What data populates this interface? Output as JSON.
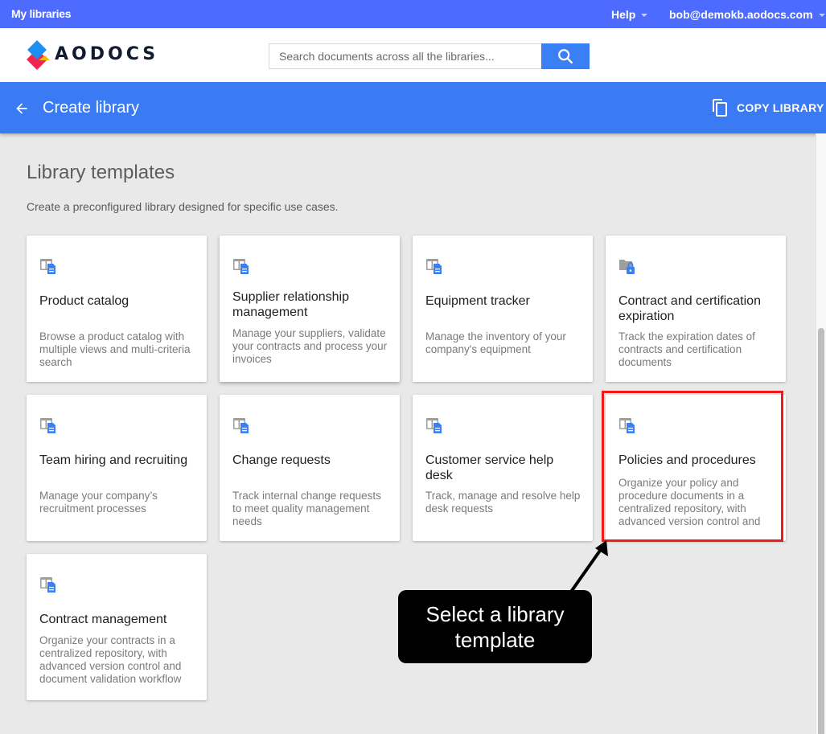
{
  "topbar": {
    "my_libraries": "My libraries",
    "help": "Help",
    "user_email": "bob@demokb.aodocs.com"
  },
  "header": {
    "logo_text": "AODOCS",
    "search_placeholder": "Search documents across all the libraries...",
    "search_value": ""
  },
  "toolbar": {
    "title": "Create library",
    "copy_library": "COPY LIBRARY"
  },
  "main": {
    "section_title": "Library templates",
    "section_subtitle": "Create a preconfigured library designed for specific use cases.",
    "templates": [
      {
        "name": "Product catalog",
        "description": "Browse a product catalog with multiple views and multi-criteria search",
        "icon": "library-document-icon"
      },
      {
        "name": "Supplier relationship management",
        "description": "Manage your suppliers, validate your contracts and process your invoices",
        "icon": "library-document-icon"
      },
      {
        "name": "Equipment tracker",
        "description": "Manage the inventory of your company's equipment",
        "icon": "library-document-icon"
      },
      {
        "name": "Contract and certification expiration",
        "description": "Track the expiration dates of contracts and certification documents",
        "icon": "secure-folder-icon"
      },
      {
        "name": "Team hiring and recruiting",
        "description": "Manage your company’s recruitment processes",
        "icon": "library-document-icon"
      },
      {
        "name": "Change requests",
        "description": "Track internal change requests to meet quality management needs",
        "icon": "library-document-icon"
      },
      {
        "name": "Customer service help desk",
        "description": "Track, manage and resolve help desk requests",
        "icon": "library-document-icon"
      },
      {
        "name": "Policies and procedures",
        "description": "Organize your policy and procedure documents in a centralized repository, with advanced version control and",
        "icon": "library-document-icon"
      },
      {
        "name": "Contract management",
        "description": "Organize your contracts in a centralized repository, with advanced version control and document validation workflow",
        "icon": "library-document-icon"
      }
    ]
  },
  "annotation": {
    "callout_text": "Select a library template",
    "highlighted_template": "Policies and procedures"
  },
  "colors": {
    "topbar": "#4d6bfe",
    "toolbar": "#3a7af3",
    "search_button": "#3b7ff5",
    "highlight": "#f01a1a"
  }
}
